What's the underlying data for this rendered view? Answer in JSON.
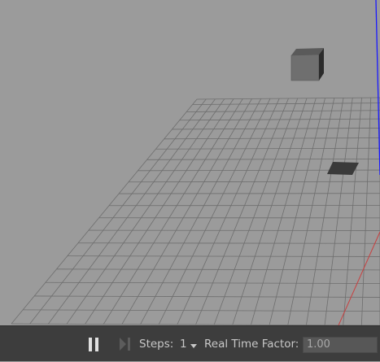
{
  "toolbar": {
    "pause_icon": "pause-icon",
    "step_icon": "step-forward-icon",
    "steps_label": "Steps:",
    "steps_value": "1",
    "rtf_label": "Real Time Factor:",
    "rtf_value": "1.00"
  },
  "colors": {
    "viewport_bg": "#9b9b9b",
    "grid_line": "#6e6e6e",
    "toolbar_bg": "#3d3d3d",
    "axis_blue": "#1a1aff",
    "axis_red": "#d23b3b"
  }
}
